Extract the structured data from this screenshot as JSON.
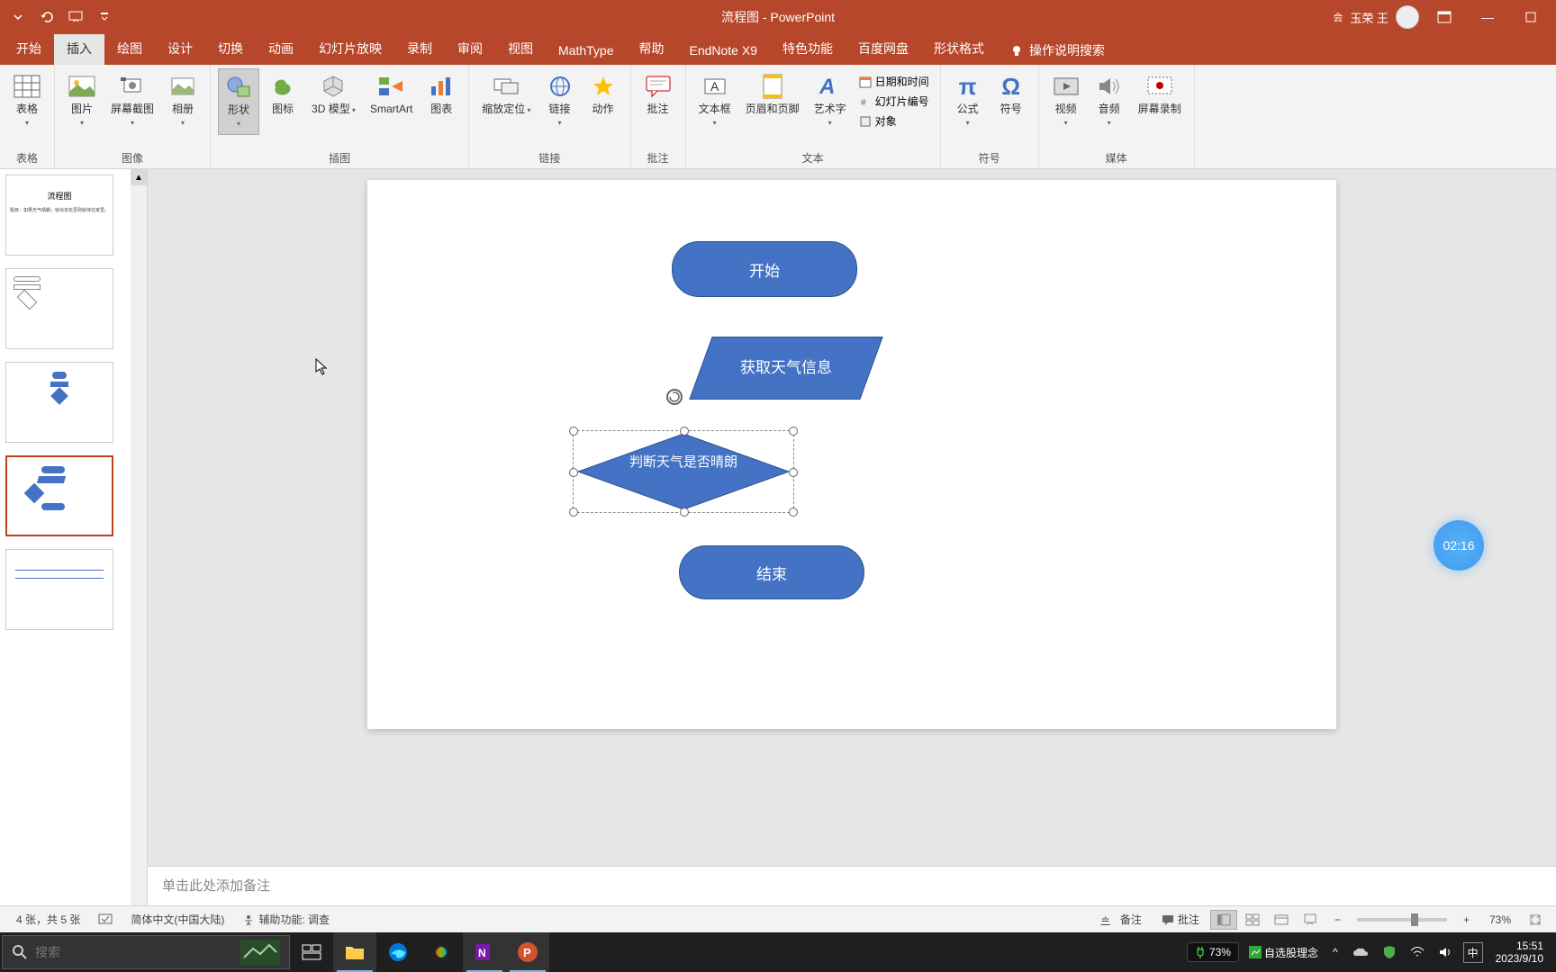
{
  "titlebar": {
    "doc_title": "流程图 - PowerPoint",
    "user_name": "玉荣 王"
  },
  "tabs": {
    "items": [
      "开始",
      "插入",
      "绘图",
      "设计",
      "切换",
      "动画",
      "幻灯片放映",
      "录制",
      "审阅",
      "视图",
      "MathType",
      "帮助",
      "EndNote X9",
      "特色功能",
      "百度网盘",
      "形状格式"
    ],
    "active_index": 1,
    "tell_me": "操作说明搜索"
  },
  "ribbon": {
    "groups": {
      "tables": {
        "label": "表格",
        "items": [
          "表格"
        ]
      },
      "images": {
        "label": "图像",
        "items": [
          "图片",
          "屏幕截图",
          "相册"
        ]
      },
      "illus": {
        "label": "插图",
        "items": [
          "形状",
          "图标",
          "3D 模型",
          "SmartArt",
          "图表"
        ]
      },
      "links": {
        "label": "链接",
        "items": [
          "缩放定位",
          "链接",
          "动作"
        ]
      },
      "comments": {
        "label": "批注",
        "items": [
          "批注"
        ]
      },
      "text": {
        "label": "文本",
        "items": [
          "文本框",
          "页眉和页脚",
          "艺术字"
        ],
        "small": [
          "日期和时间",
          "幻灯片编号",
          "对象"
        ]
      },
      "symbols": {
        "label": "符号",
        "items": [
          "公式",
          "符号"
        ]
      },
      "media": {
        "label": "媒体",
        "items": [
          "视频",
          "音频",
          "屏幕录制"
        ]
      }
    }
  },
  "slide_thumbs": {
    "count": 5,
    "active_index": 3,
    "thumb1_title": "流程图",
    "thumb1_sub": "题目：如果天气晴朗，就出去玩否则就待在家里。"
  },
  "slide": {
    "shape_start": "开始",
    "shape_input": "获取天气信息",
    "shape_decision": "判断天气是否晴朗",
    "shape_end": "结束"
  },
  "timer": "02:16",
  "notes_placeholder": "单击此处添加备注",
  "statusbar": {
    "slide_info": "4 张，共 5 张",
    "language": "简体中文(中国大陆)",
    "accessibility": "辅助功能: 调查",
    "notes_btn": "备注",
    "comments_btn": "批注",
    "zoom": "73%"
  },
  "taskbar": {
    "search_placeholder": "搜索",
    "battery": "73%",
    "tray_text": "自选股理念",
    "ime": "中",
    "time": "15:51",
    "date": "2023/9/10"
  }
}
